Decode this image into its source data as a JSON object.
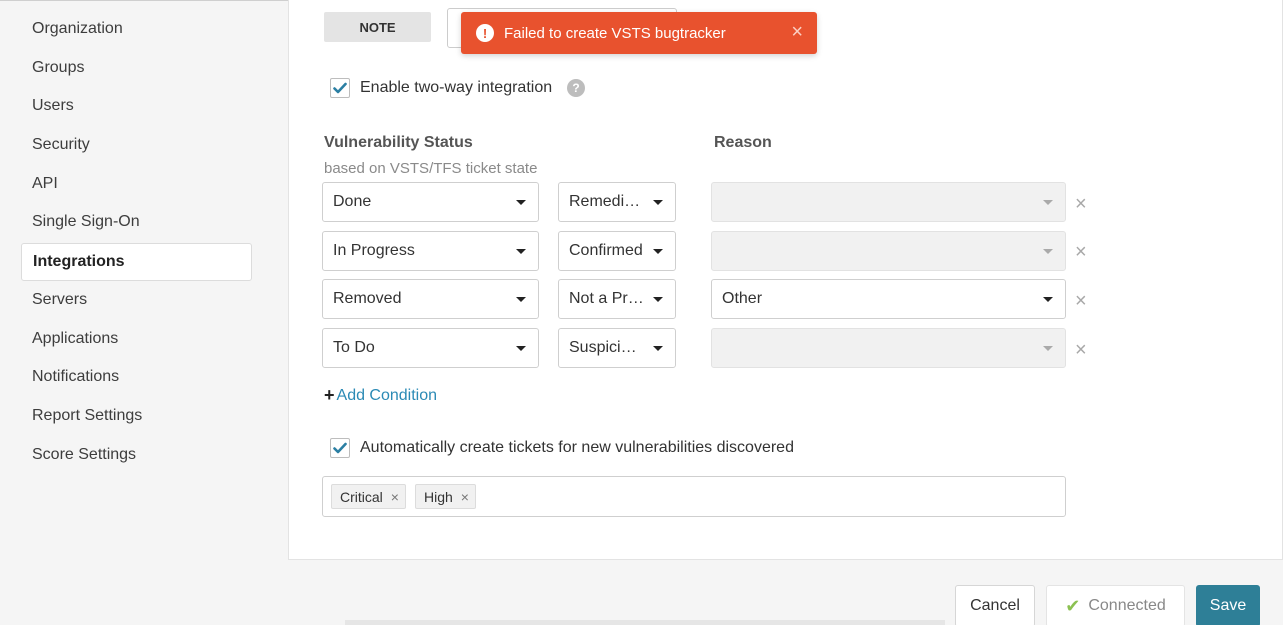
{
  "sidebar": {
    "items": [
      {
        "label": "Organization"
      },
      {
        "label": "Groups"
      },
      {
        "label": "Users"
      },
      {
        "label": "Security"
      },
      {
        "label": "API"
      },
      {
        "label": "Single Sign-On"
      },
      {
        "label": "Integrations",
        "active": true
      },
      {
        "label": "Servers"
      },
      {
        "label": "Applications"
      },
      {
        "label": "Notifications"
      },
      {
        "label": "Report Settings"
      },
      {
        "label": "Score Settings"
      }
    ]
  },
  "toast": {
    "message": "Failed to create VSTS bugtracker",
    "icon": "exclamation-circle-icon",
    "color": "#e8522e"
  },
  "note_button": {
    "label": "NOTE"
  },
  "two_way": {
    "label": "Enable two-way integration",
    "checked": true
  },
  "table": {
    "status_header": "Vulnerability Status",
    "status_sub": "based on VSTS/TFS ticket state",
    "reason_header": "Reason",
    "rows": [
      {
        "ticket_state": "Done",
        "status": "Remediated",
        "reason": ""
      },
      {
        "ticket_state": "In Progress",
        "status": "Confirmed",
        "reason": ""
      },
      {
        "ticket_state": "Removed",
        "status": "Not a Problem",
        "reason": "Other"
      },
      {
        "ticket_state": "To Do",
        "status": "Suspicious",
        "reason": ""
      }
    ]
  },
  "add_condition": {
    "label": "Add Condition"
  },
  "auto_create": {
    "label": "Automatically create tickets for new vulnerabilities discovered",
    "checked": true
  },
  "severity_tags": [
    "Critical",
    "High"
  ],
  "footer": {
    "cancel_label": "Cancel",
    "connected_label": "Connected",
    "save_label": "Save"
  },
  "colors": {
    "accent": "#2e7f97",
    "link": "#2b8ab5",
    "check": "#2b7fa3",
    "success": "#8cc152"
  }
}
